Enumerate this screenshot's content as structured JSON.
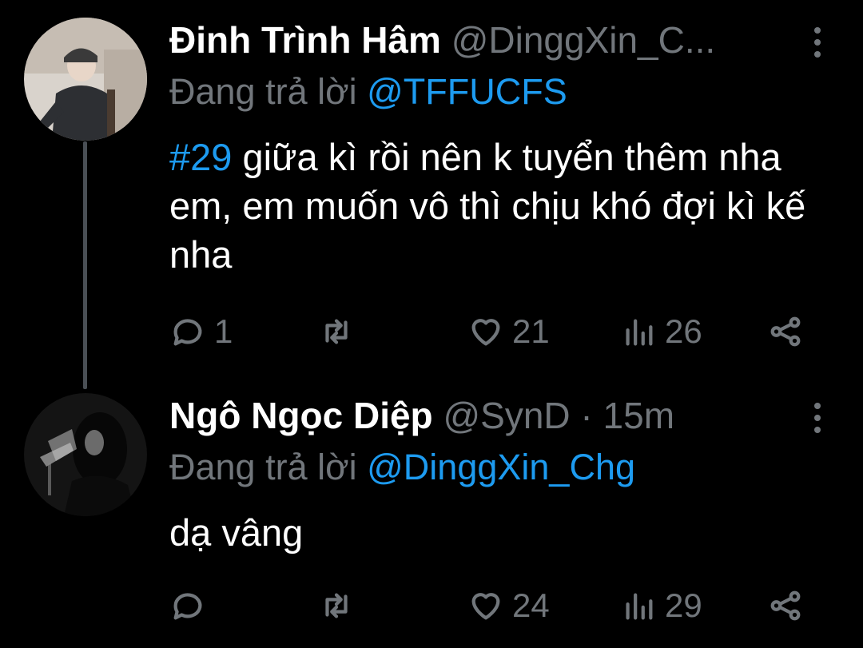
{
  "tweets": [
    {
      "display_name": "Đinh Trình Hâm",
      "handle": "@DinggXin_C...",
      "replying_prefix": "Đang trả lời",
      "replying_to": "@TFFUCFS",
      "hashtag": "#29",
      "text": " giữa kì rồi nên k tuyển thêm nha em, em muốn vô thì chịu khó đợi kì kế nha",
      "stats": {
        "replies": "1",
        "retweets": "",
        "likes": "21",
        "views": "26"
      }
    },
    {
      "display_name": "Ngô Ngọc Diệp",
      "handle": "@SynD",
      "separator": "·",
      "time": "15m",
      "replying_prefix": "Đang trả lời",
      "replying_to": "@DinggXin_Chg",
      "text": "dạ vâng",
      "stats": {
        "replies": "",
        "retweets": "",
        "likes": "24",
        "views": "29"
      }
    }
  ],
  "icons": [
    "reply-icon",
    "retweet-icon",
    "like-icon",
    "views-icon",
    "share-icon",
    "more-icon"
  ],
  "colors": {
    "background": "#000000",
    "text": "#ffffff",
    "muted": "#71767b",
    "accent": "#1d9bf0"
  }
}
